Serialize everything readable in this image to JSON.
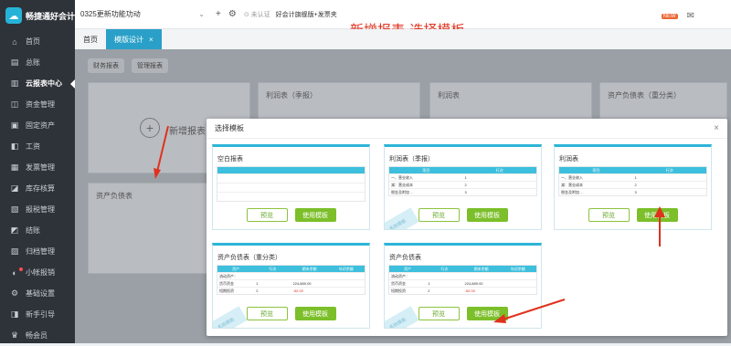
{
  "app": {
    "logo_text": "畅捷通好会计"
  },
  "sidebar": {
    "items": [
      {
        "icon": "home-icon",
        "glyph": "⌂",
        "label": "首页"
      },
      {
        "icon": "ledger-icon",
        "glyph": "▤",
        "label": "总账"
      },
      {
        "icon": "chart-icon",
        "glyph": "▥",
        "label": "云报表中心",
        "active": true
      },
      {
        "icon": "fund-icon",
        "glyph": "◫",
        "label": "资金管理"
      },
      {
        "icon": "asset-icon",
        "glyph": "▣",
        "label": "固定资产"
      },
      {
        "icon": "salary-icon",
        "glyph": "◧",
        "label": "工资"
      },
      {
        "icon": "invoice-icon",
        "glyph": "▦",
        "label": "发票管理"
      },
      {
        "icon": "inventory-icon",
        "glyph": "◪",
        "label": "库存核算"
      },
      {
        "icon": "tax-icon",
        "glyph": "▧",
        "label": "报税管理"
      },
      {
        "icon": "close-icon",
        "glyph": "◩",
        "label": "结账"
      },
      {
        "icon": "archive-icon",
        "glyph": "▨",
        "label": "归档管理"
      },
      {
        "icon": "expense-icon",
        "glyph": "◐",
        "label": "小帐报销",
        "dot": true
      },
      {
        "icon": "settings-icon",
        "glyph": "⚙",
        "label": "基础设置"
      },
      {
        "icon": "guide-icon",
        "glyph": "◨",
        "label": "新手引导"
      },
      {
        "icon": "member-icon",
        "glyph": "♛",
        "label": "畅会员"
      }
    ]
  },
  "topbar": {
    "company": "0325更新功能功动",
    "cert": "未认证",
    "plan": "好会计旗舰版+发票夹"
  },
  "annotation": "新增报表-选择模板",
  "tabs": [
    {
      "label": "首页",
      "active": false
    },
    {
      "label": "模版设计",
      "active": true,
      "close": "×"
    }
  ],
  "background": {
    "subtabs": [
      "财务报表",
      "管理报表"
    ],
    "add_label": "新增报表",
    "cards": [
      "利润表（季报）",
      "利润表",
      "资产负债表（重分类）",
      "资产负债表"
    ]
  },
  "modal": {
    "title": "选择模板",
    "close": "×",
    "preview_label": "预览",
    "use_label": "使用模板",
    "ribbon": "系统模板",
    "templates": [
      {
        "title": "空白报表",
        "type": "blank"
      },
      {
        "title": "利润表（季报）",
        "type": "profit",
        "head": [
          "项目",
          "行次"
        ],
        "rows": [
          [
            "一、营业收入",
            "1"
          ],
          [
            "减：营业成本",
            "2"
          ],
          [
            "税金及附加 ...",
            "3"
          ]
        ]
      },
      {
        "title": "利润表",
        "type": "profit",
        "head": [
          "项目",
          "行次"
        ],
        "rows": [
          [
            "一、营业收入",
            "1"
          ],
          [
            "减：营业成本",
            "2"
          ],
          [
            "税金及附加 ...",
            "3"
          ]
        ]
      },
      {
        "title": "资产负债表（重分类）",
        "type": "balance",
        "head": [
          "资产",
          "行次",
          "期末余额",
          "年初余额"
        ],
        "rows": [
          [
            "流动资产：",
            "",
            "",
            ""
          ],
          [
            "货币资金",
            "1",
            "224,889.00",
            ""
          ],
          [
            "短期投资",
            "2",
            "-52.00",
            ""
          ]
        ]
      },
      {
        "title": "资产负债表",
        "type": "balance",
        "head": [
          "资产",
          "行次",
          "期末余额",
          "年初余额"
        ],
        "rows": [
          [
            "流动资产：",
            "",
            "",
            ""
          ],
          [
            "货币资金",
            "1",
            "224,889.00",
            ""
          ],
          [
            "短期投资",
            "2",
            "-52.00",
            ""
          ]
        ]
      }
    ]
  }
}
